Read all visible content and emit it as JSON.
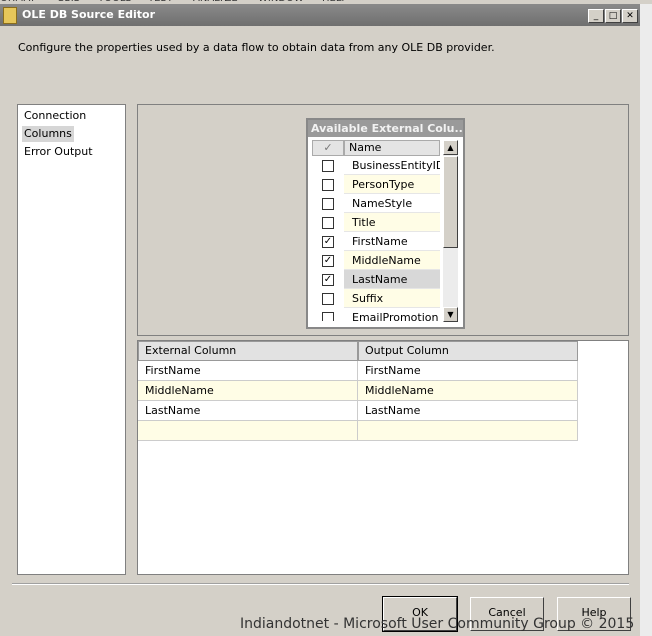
{
  "menu_strip": [
    "ORMAT",
    "SSIS",
    "TOOLS",
    "TEST",
    "ANALYZE",
    "WINDOW",
    "HELP"
  ],
  "window": {
    "title": "OLE DB Source Editor",
    "controls": {
      "minimize": "_",
      "maximize": "□",
      "close": "✕"
    }
  },
  "description": "Configure the properties used by a data flow to obtain data from any OLE DB provider.",
  "nav": {
    "items": [
      {
        "label": "Connection Manager",
        "selected": false
      },
      {
        "label": "Columns",
        "selected": true
      },
      {
        "label": "Error Output",
        "selected": false
      }
    ]
  },
  "available_columns": {
    "title": "Available External Colu...",
    "header_name": "Name",
    "header_check": "✓",
    "rows": [
      {
        "name": "BusinessEntityID",
        "checked": false
      },
      {
        "name": "PersonType",
        "checked": false
      },
      {
        "name": "NameStyle",
        "checked": false
      },
      {
        "name": "Title",
        "checked": false
      },
      {
        "name": "FirstName",
        "checked": true
      },
      {
        "name": "MiddleName",
        "checked": true
      },
      {
        "name": "LastName",
        "checked": true
      },
      {
        "name": "Suffix",
        "checked": false
      },
      {
        "name": "EmailPromotion",
        "checked": false
      }
    ],
    "scroll_up": "▲",
    "scroll_down": "▼"
  },
  "mapping_grid": {
    "headers": [
      "External Column",
      "Output Column"
    ],
    "rows": [
      [
        "FirstName",
        "FirstName"
      ],
      [
        "MiddleName",
        "MiddleName"
      ],
      [
        "LastName",
        "LastName"
      ],
      [
        "",
        ""
      ]
    ]
  },
  "buttons": {
    "ok": "OK",
    "cancel": "Cancel",
    "help": "Help"
  },
  "watermark": "Indiandotnet - Microsoft User Community Group © 2015"
}
